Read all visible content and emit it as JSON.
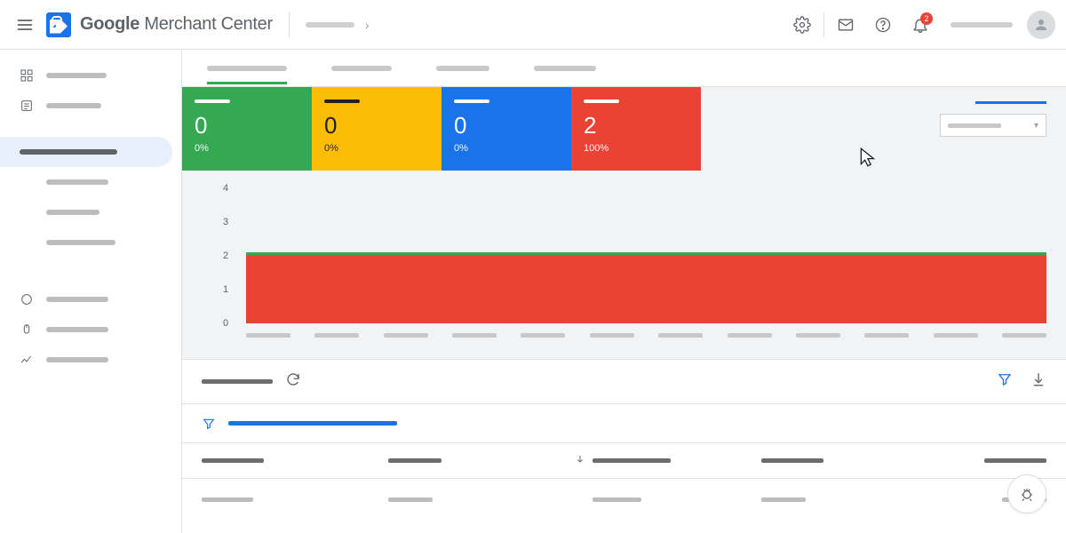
{
  "header": {
    "product_name_bold": "Google",
    "product_name_rest": " Merchant Center",
    "notification_count": "2"
  },
  "cards": [
    {
      "value": "0",
      "pct": "0%"
    },
    {
      "value": "0",
      "pct": "0%"
    },
    {
      "value": "0",
      "pct": "0%"
    },
    {
      "value": "2",
      "pct": "100%"
    }
  ],
  "chart_data": {
    "type": "area",
    "ylabel": "",
    "ylim": [
      0,
      4
    ],
    "yticks": [
      "0",
      "1",
      "2",
      "3",
      "4"
    ],
    "x_count": 12,
    "series": [
      {
        "name": "disapproved",
        "color": "#ea4335",
        "constant_value": 2
      },
      {
        "name": "active",
        "color": "#34a853",
        "constant_value": 2
      }
    ],
    "note": "Red filled area from 0 to 2 across all x; green line at y=2 on top of it."
  },
  "table": {
    "columns": 5,
    "sort_column_index": 2
  }
}
